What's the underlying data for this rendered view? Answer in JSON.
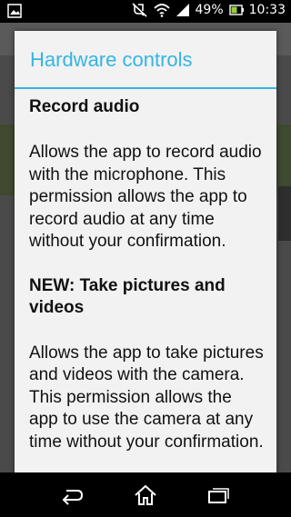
{
  "status_bar": {
    "battery_percent": "49%",
    "time": "10:33",
    "icons": [
      "gallery-notification-icon",
      "mute-icon",
      "wifi-icon",
      "signal-icon",
      "battery-icon"
    ]
  },
  "dialog": {
    "title": "Hardware controls",
    "accent_color": "#33b5e5",
    "permissions": [
      {
        "title": "Record audio",
        "description": "Allows the app to record audio with the microphone. This permission allows the app to record audio at any time without your confirmation."
      },
      {
        "title": "NEW: Take pictures and videos",
        "description": "Allows the app to take pictures and videos with the camera. This permission allows the app to use the camera at any time without your confirmation."
      }
    ]
  },
  "nav_bar": {
    "buttons": [
      "back-icon",
      "home-icon",
      "recent-apps-icon"
    ]
  }
}
